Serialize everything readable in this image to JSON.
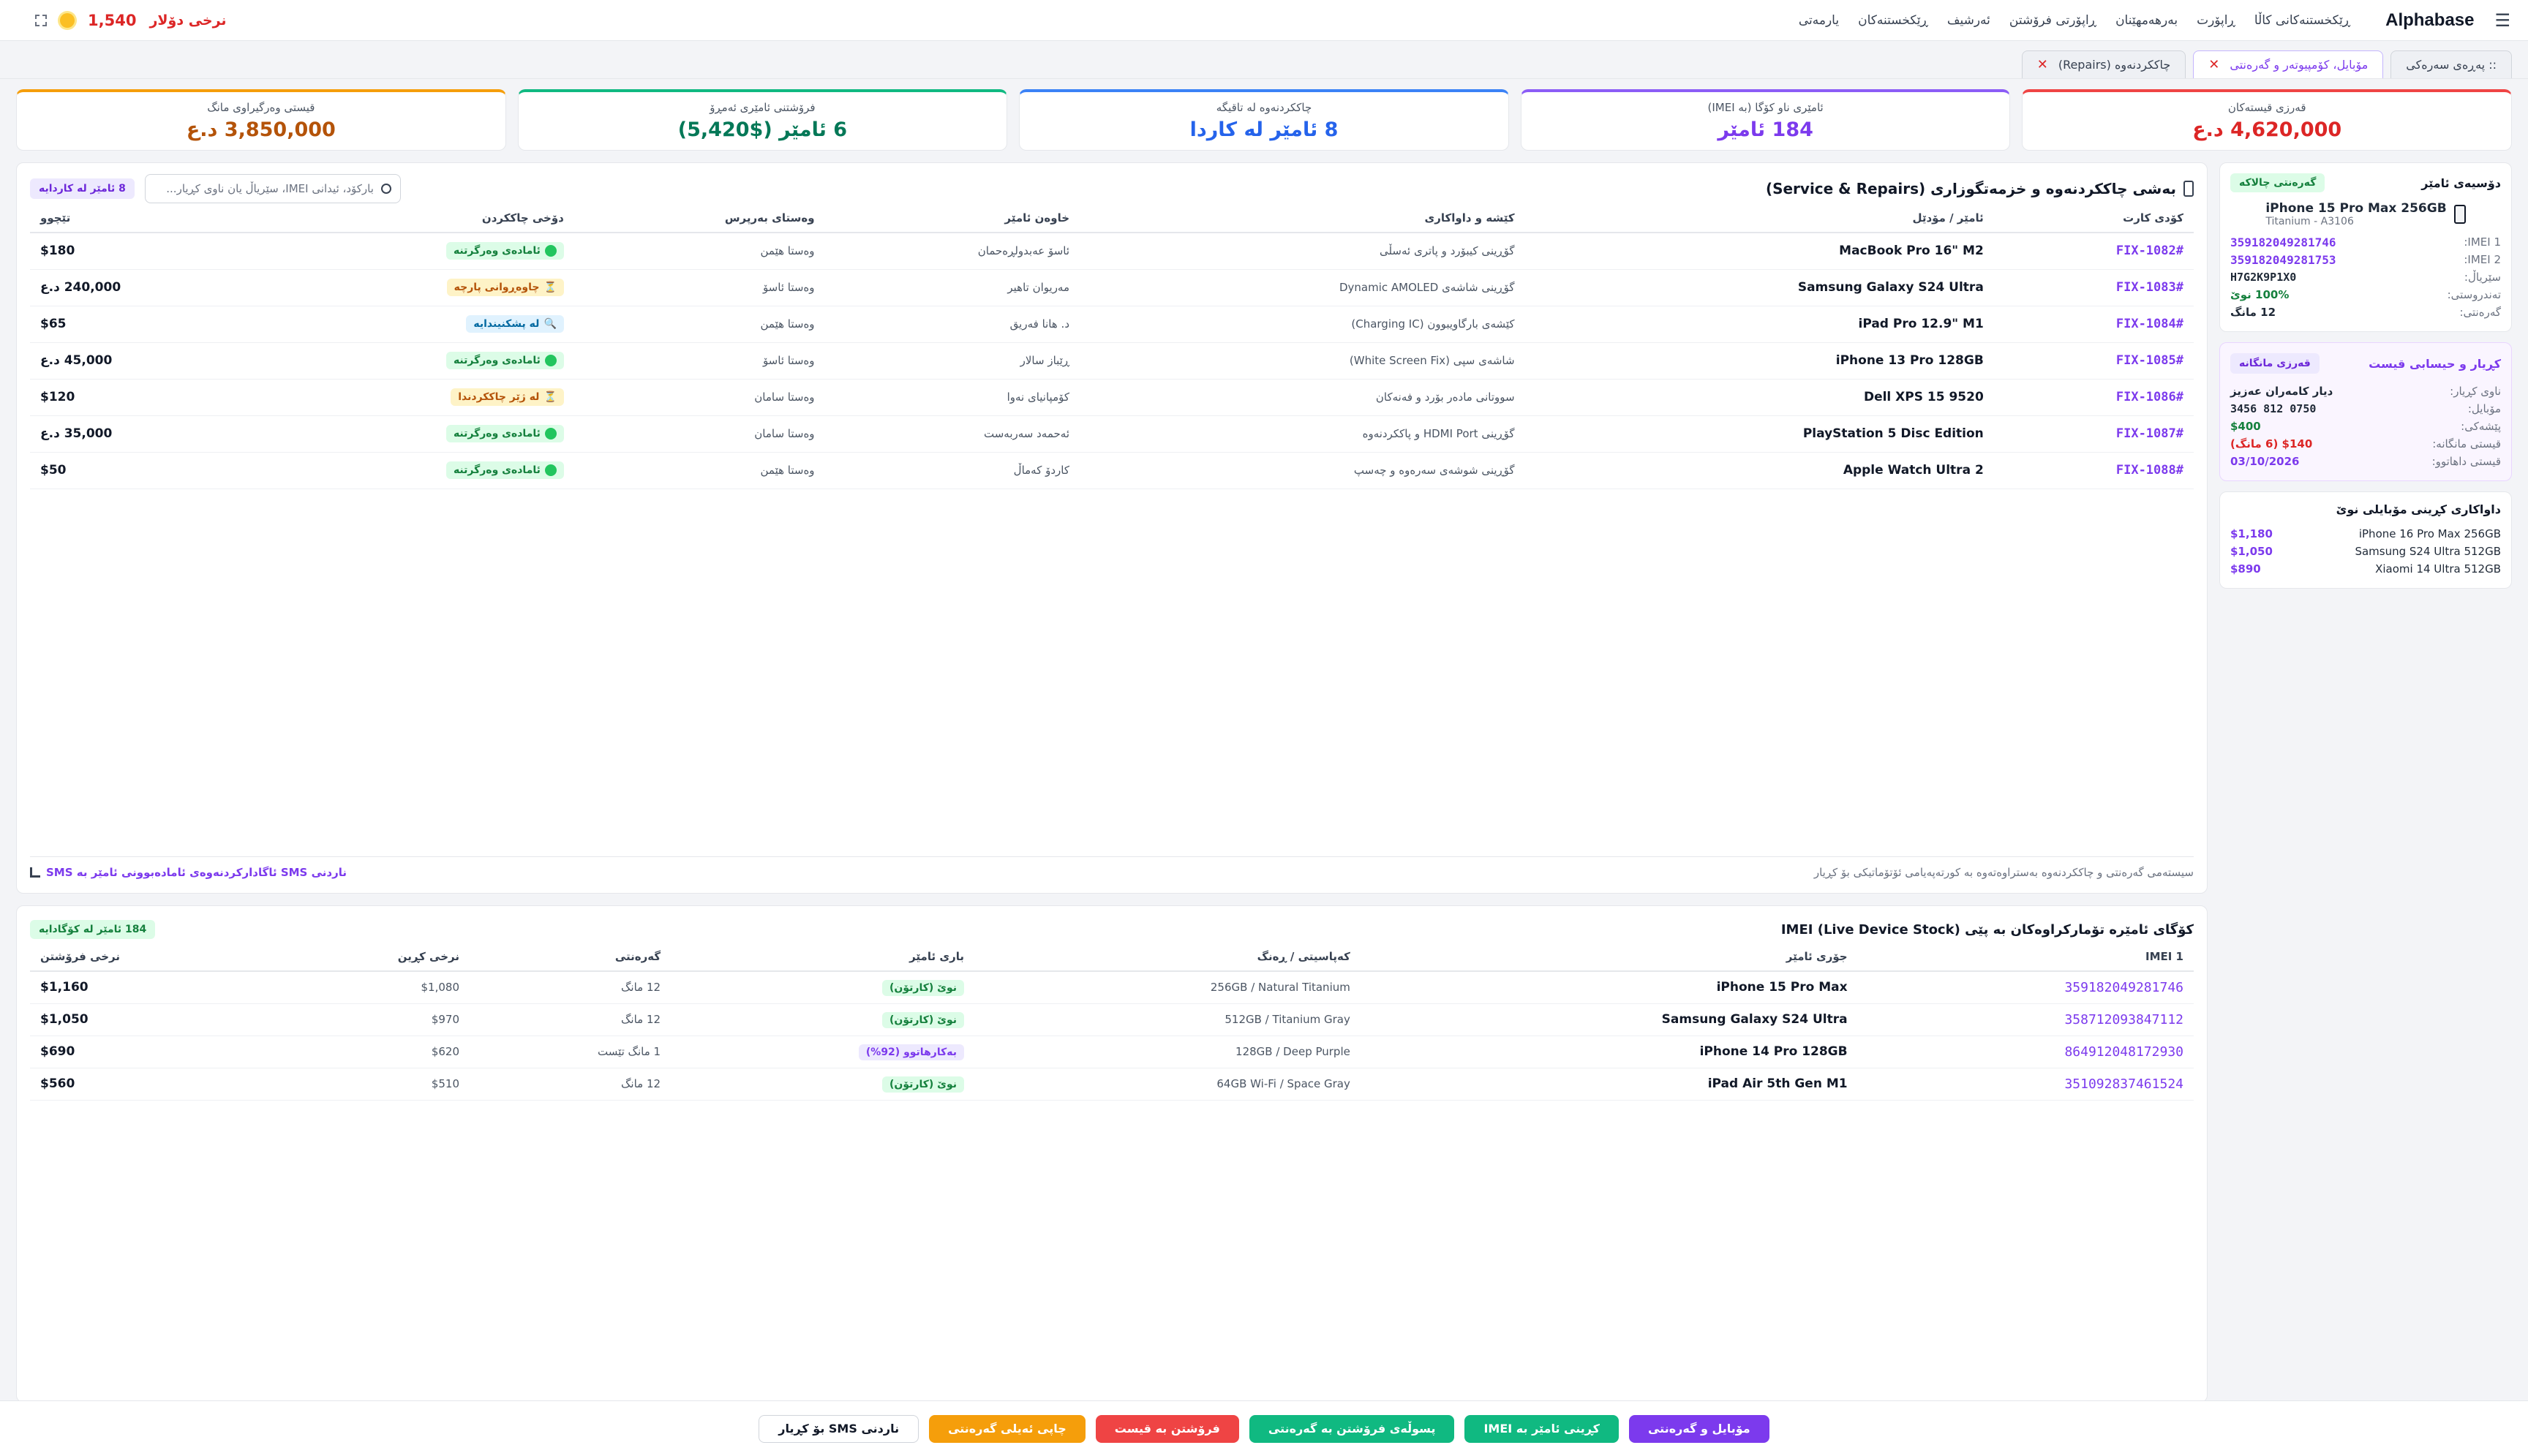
{
  "topbar": {
    "brand": "Alphabase",
    "nav": [
      "ڕێکخستنەکانی کاڵا",
      "ڕاپۆرت",
      "بەرهەمهێنان",
      "ڕاپۆرتی فرۆشتن",
      "ئەرشیف",
      "ڕێکخستنەکان",
      "یارمەتی"
    ],
    "rate_label": "نرخی دۆلار",
    "rate_value": "1,540"
  },
  "tabs": [
    {
      "label": ":: پەڕەی سەرەکی",
      "closable": false,
      "active": false
    },
    {
      "label": "مۆبایل، کۆمپیوتەر و گەرەنتی",
      "closable": true,
      "active": true
    },
    {
      "label": "چاککردنەوە (Repairs)",
      "closable": true,
      "active": false
    }
  ],
  "kpis": [
    {
      "label": "قەرزی قیستەکان",
      "value": "4,620,000 د.ع",
      "color": "#dc2626"
    },
    {
      "label": "ئامێری ناو کۆگا (بە IMEI)",
      "value": "184 ئامێر",
      "color": "#7c3aed"
    },
    {
      "label": "چاککردنەوە لە تاقیگە",
      "value": "8 ئامێر لە کاردا",
      "color": "#2563eb"
    },
    {
      "label": "فرۆشتنی ئامێری ئەمڕۆ",
      "value": "6 ئامێر ($5,420)",
      "color": "#059669"
    },
    {
      "label": "قیستی وەرگیراوی مانگ",
      "value": "3,850,000 د.ع",
      "color": "#d97706"
    }
  ],
  "service": {
    "title": "بەشی چاککردنەوە و خزمەتگوزاری (Service & Repairs)",
    "search_placeholder": "بارکۆد، ئیدانی IMEI، سێریاڵ یان ناوی کڕیار...",
    "badge": "8 ئامێر لە کاردایە",
    "columns": [
      "کۆدی کارت",
      "ئامێر / مۆدێل",
      "کێشە و داواکاری",
      "خاوەن ئامێر",
      "وەستای بەرپرس",
      "دۆخی چاککردن",
      "تێچوو"
    ],
    "rows": [
      {
        "code": "#FIX-1082",
        "device": "MacBook Pro 16\" M2",
        "issue": "گۆڕینی کیبۆرد و پاتری ئەسڵی",
        "owner": "ئاسۆ عەبدولڕەحمان",
        "tech": "وەستا هێمن",
        "status": "ئامادەی وەرگرتنە",
        "status_type": "green",
        "cost": "$180"
      },
      {
        "code": "#FIX-1083",
        "device": "Samsung Galaxy S24 Ultra",
        "issue": "گۆڕینی شاشەی Dynamic AMOLED",
        "owner": "مەریوان تاهیر",
        "tech": "وەستا ئاسۆ",
        "status": "چاوەڕوانی پارچە",
        "status_type": "amber",
        "cost": "240,000 د.ع"
      },
      {
        "code": "#FIX-1084",
        "device": "iPad Pro 12.9\" M1",
        "issue": "کێشەی بارگاویبوون (Charging IC)",
        "owner": "د. هانا فەریق",
        "tech": "وەستا هێمن",
        "status": "لە پشکنیندایە",
        "status_type": "blue",
        "cost": "$65"
      },
      {
        "code": "#FIX-1085",
        "device": "iPhone 13 Pro 128GB",
        "issue": "شاشەی سپی (White Screen Fix)",
        "owner": "ڕێباز سالار",
        "tech": "وەستا ئاسۆ",
        "status": "ئامادەی وەرگرتنە",
        "status_type": "green",
        "cost": "45,000 د.ع"
      },
      {
        "code": "#FIX-1086",
        "device": "Dell XPS 15 9520",
        "issue": "سووتانی مادەر بۆرد و فەنەکان",
        "owner": "کۆمپانیای نەوا",
        "tech": "وەستا سامان",
        "status": "لە ژێر چاککردندا",
        "status_type": "amber",
        "cost": "$120"
      },
      {
        "code": "#FIX-1087",
        "device": "PlayStation 5 Disc Edition",
        "issue": "گۆڕینی HDMI Port و پاککردنەوە",
        "owner": "ئەحمەد سەربەست",
        "tech": "وەستا سامان",
        "status": "ئامادەی وەرگرتنە",
        "status_type": "green",
        "cost": "35,000 د.ع"
      },
      {
        "code": "#FIX-1088",
        "device": "Apple Watch Ultra 2",
        "issue": "گۆڕینی شوشەی سەرەوە و چەسپ",
        "owner": "کاردۆ کەماڵ",
        "tech": "وەستا هێمن",
        "status": "ئامادەی وەرگرتنە",
        "status_type": "green",
        "cost": "$50"
      }
    ],
    "footer_note": "سیستەمی گەرەنتی و چاککردنەوە بەستراوەتەوە بە کورتەپەیامی ئۆتۆماتیکی بۆ کڕیار",
    "footer_sms": "ناردنی SMS ئاگادارکردنەوەی ئامادەبوونی ئامێر بە SMS"
  },
  "imei": {
    "title": "کۆگای ئامێرە تۆمارکراوەکان بە پێی IMEI (Live Device Stock)",
    "badge": "184 ئامێر لە کۆگادایە",
    "columns": [
      "IMEI 1",
      "جۆری ئامێر",
      "کەپاسیتی / ڕەنگ",
      "باری ئامێر",
      "گەرەنتی",
      "نرخی کڕین",
      "نرخی فرۆشتن"
    ],
    "rows": [
      {
        "imei": "359182049281746",
        "device": "iPhone 15 Pro Max",
        "spec": "256GB / Natural Titanium",
        "cond": "نوێ (کارتۆن)",
        "cond_type": "new",
        "warranty": "12 مانگ",
        "buy": "$1,080",
        "sell": "$1,160"
      },
      {
        "imei": "358712093847112",
        "device": "Samsung Galaxy S24 Ultra",
        "spec": "512GB / Titanium Gray",
        "cond": "نوێ (کارتۆن)",
        "cond_type": "new",
        "warranty": "12 مانگ",
        "buy": "$970",
        "sell": "$1,050"
      },
      {
        "imei": "864912048172930",
        "device": "iPhone 14 Pro 128GB",
        "spec": "128GB / Deep Purple",
        "cond": "بەکارهاتوو (92%)",
        "cond_type": "used",
        "warranty": "1 مانگ تێست",
        "buy": "$620",
        "sell": "$690"
      },
      {
        "imei": "351092837461524",
        "device": "iPad Air 5th Gen M1",
        "spec": "64GB Wi-Fi / Space Gray",
        "cond": "نوێ (کارتۆن)",
        "cond_type": "new",
        "warranty": "12 مانگ",
        "buy": "$510",
        "sell": "$560"
      }
    ]
  },
  "sidebar": {
    "device_card": {
      "title": "دۆسیەی ئامێر",
      "badge": "گەرەنتی چالاکە",
      "device_name": "iPhone 15 Pro Max 256GB",
      "device_sub": "Titanium - A3106",
      "fields": [
        {
          "k": "IMEI 1:",
          "v": "359182049281746"
        },
        {
          "k": "IMEI 2:",
          "v": "359182049281753"
        },
        {
          "k": "سێریاڵ:",
          "v": "H7G2K9P1X0"
        },
        {
          "k": "تەندروستی:",
          "v": "100% نوێ"
        },
        {
          "k": "گەرەنتی:",
          "v": "12 مانگ"
        }
      ]
    },
    "customer_card": {
      "title": "کڕیار و حیسابی قیست",
      "badge": "قەرزی مانگانە",
      "fields": [
        {
          "k": "ناوی کڕیار:",
          "v": "دیار کامەران عەزیز"
        },
        {
          "k": "مۆبایل:",
          "v": "0750 812 3456"
        },
        {
          "k": "پێشەکی:",
          "v": "$400"
        },
        {
          "k": "قیستی مانگانە:",
          "v": "$140 (6 مانگ)"
        },
        {
          "k": "قیستی داهاتوو:",
          "v": "03/10/2026"
        }
      ]
    },
    "prices_card": {
      "title": "داواکاری کڕینی مۆبایلی نوێ",
      "items": [
        {
          "name": "iPhone 16 Pro Max 256GB",
          "price": "$1,180"
        },
        {
          "name": "Samsung S24 Ultra 512GB",
          "price": "$1,050"
        },
        {
          "name": "Xiaomi 14 Ultra 512GB",
          "price": "$890"
        }
      ]
    }
  },
  "actions": [
    {
      "label": "مۆبایل و گەرەنتی",
      "style": "purple"
    },
    {
      "label": "کڕینی ئامێر بە IMEI",
      "style": "teal"
    },
    {
      "label": "پسوڵەی فرۆشتن بە گەرەنتی",
      "style": "teal"
    },
    {
      "label": "فرۆشتن بە قیست",
      "style": "red"
    },
    {
      "label": "چاپی ئەیلی گەرەنتی",
      "style": "orange"
    },
    {
      "label": "ناردنی SMS بۆ کڕیار",
      "style": "outline"
    }
  ]
}
